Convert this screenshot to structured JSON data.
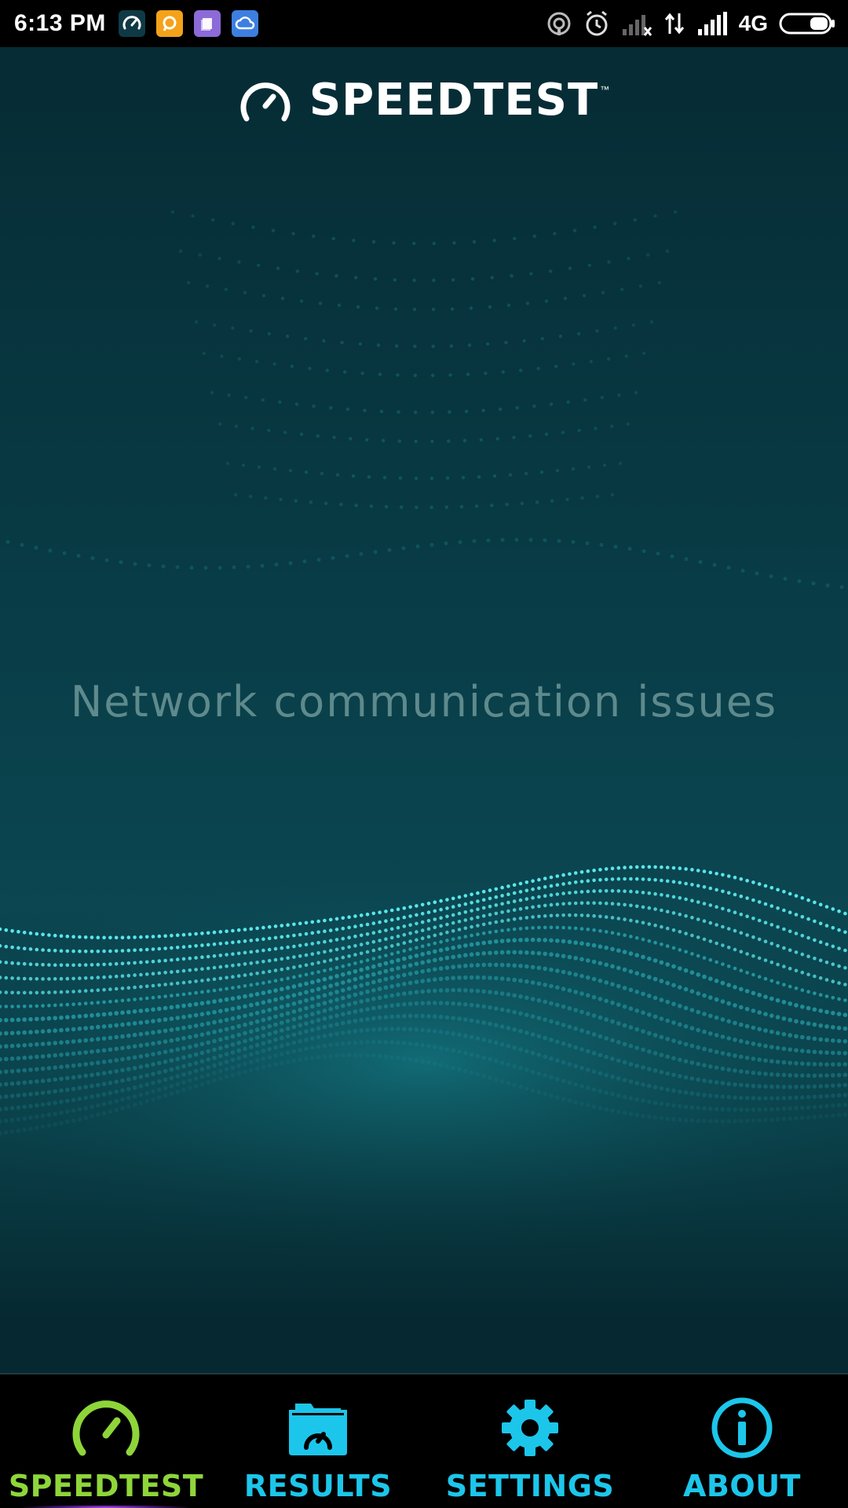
{
  "status_bar": {
    "time": "6:13 PM",
    "network": "4G",
    "notification_icons": [
      "speedtest-notification-icon",
      "chat-notification-icon",
      "notes-notification-icon",
      "cloud-notification-icon"
    ],
    "system_icons": [
      "hotspot-icon",
      "alarm-icon",
      "no-signal-icon",
      "data-transfer-icon",
      "signal-icon",
      "battery-icon"
    ]
  },
  "header": {
    "logo_text": "SPEEDTEST",
    "trademark": "™"
  },
  "main": {
    "message": "Network communication issues"
  },
  "nav": {
    "items": [
      {
        "label": "SPEEDTEST",
        "icon": "speedometer-icon",
        "active": true
      },
      {
        "label": "RESULTS",
        "icon": "results-folder-icon",
        "active": false
      },
      {
        "label": "SETTINGS",
        "icon": "gear-icon",
        "active": false
      },
      {
        "label": "ABOUT",
        "icon": "info-icon",
        "active": false
      }
    ]
  },
  "colors": {
    "active_tab": "#8ed53a",
    "inactive_tab": "#1cc6ea",
    "message_text": "#5e8a8d",
    "background": "#083a44"
  }
}
